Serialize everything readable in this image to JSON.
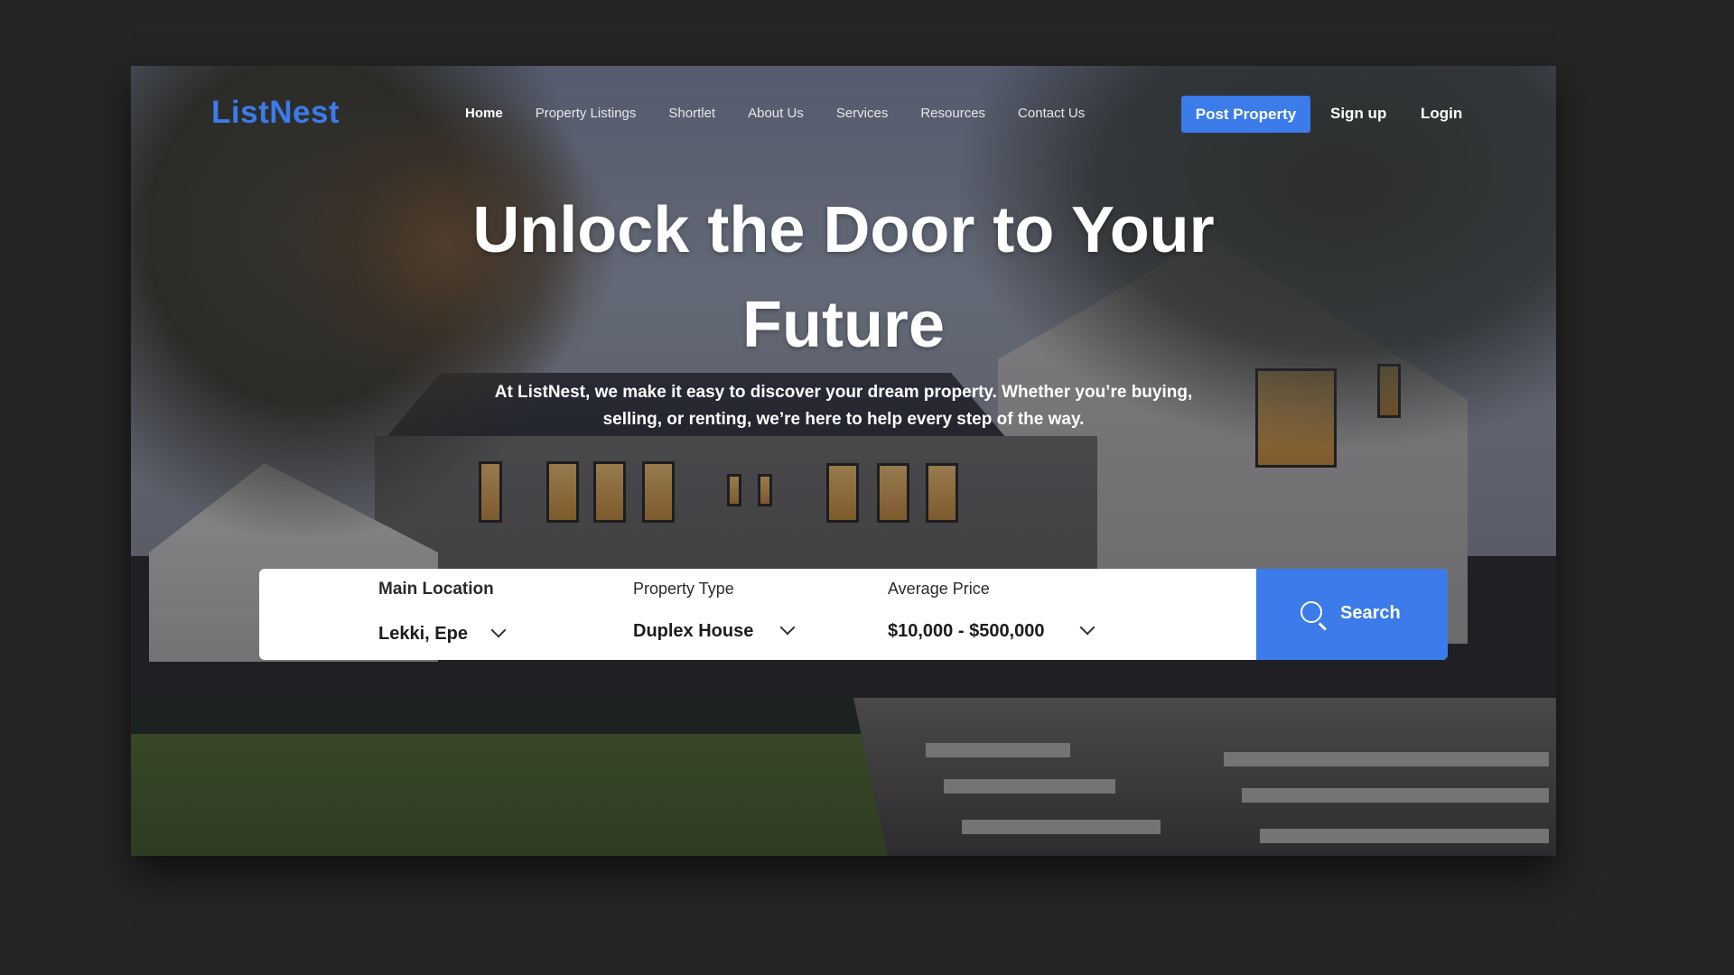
{
  "brand": {
    "logo": "ListNest",
    "accent": "#3b7bea"
  },
  "nav": {
    "links": [
      {
        "label": "Home",
        "active": true
      },
      {
        "label": "Property Listings"
      },
      {
        "label": "Shortlet"
      },
      {
        "label": "About Us"
      },
      {
        "label": "Services"
      },
      {
        "label": "Resources"
      },
      {
        "label": "Contact Us"
      }
    ],
    "post_property": "Post Property",
    "sign_up": "Sign up",
    "login": "Login"
  },
  "hero": {
    "title_line1": "Unlock the Door to Your",
    "title_line2": "Future",
    "subtitle": "At ListNest, we make it easy to discover your dream property. Whether you’re buying, selling, or renting, we’re here to help every step of the way."
  },
  "search": {
    "location": {
      "label": "Main Location",
      "value": "Lekki, Epe"
    },
    "property_type": {
      "label": "Property Type",
      "value": "Duplex House"
    },
    "price": {
      "label": "Average Price",
      "value": "$10,000 - $500,000"
    },
    "button": "Search",
    "icons": {
      "button": "search-icon",
      "dropdown": "chevron-down-icon"
    }
  }
}
